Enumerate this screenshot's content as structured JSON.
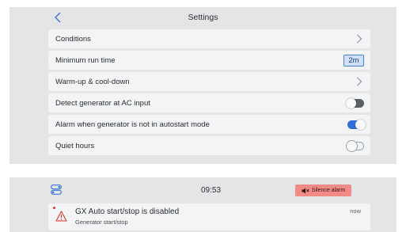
{
  "settings": {
    "title": "Settings",
    "rows": [
      {
        "label": "Conditions",
        "control": "chevron"
      },
      {
        "label": "Minimum run time",
        "control": "value",
        "value": "2m"
      },
      {
        "label": "Warm-up & cool-down",
        "control": "chevron"
      },
      {
        "label": "Detect generator at AC input",
        "control": "toggle",
        "state": "off"
      },
      {
        "label": "Alarm when generator is not in autostart mode",
        "control": "toggle",
        "state": "on"
      },
      {
        "label": "Quiet hours",
        "control": "toggle",
        "state": "off"
      }
    ]
  },
  "statusbar": {
    "time": "09:53",
    "silence_label": "Silence alarm"
  },
  "notification": {
    "title": "GX Auto start/stop is disabled",
    "subtitle": "Generator start/stop",
    "time": "now"
  },
  "icons": {
    "back": "chevron-left-icon",
    "row_chevron": "chevron-right-icon",
    "menu": "toggle-menu-icon",
    "mute": "speaker-mute-icon",
    "warning": "warning-triangle-icon"
  },
  "colors": {
    "accent": "#2f6fdc",
    "alarm": "#f08b86",
    "warning": "#e0362f",
    "panel_bg": "#e4e5e7",
    "row_bg": "#f3f4f5"
  }
}
